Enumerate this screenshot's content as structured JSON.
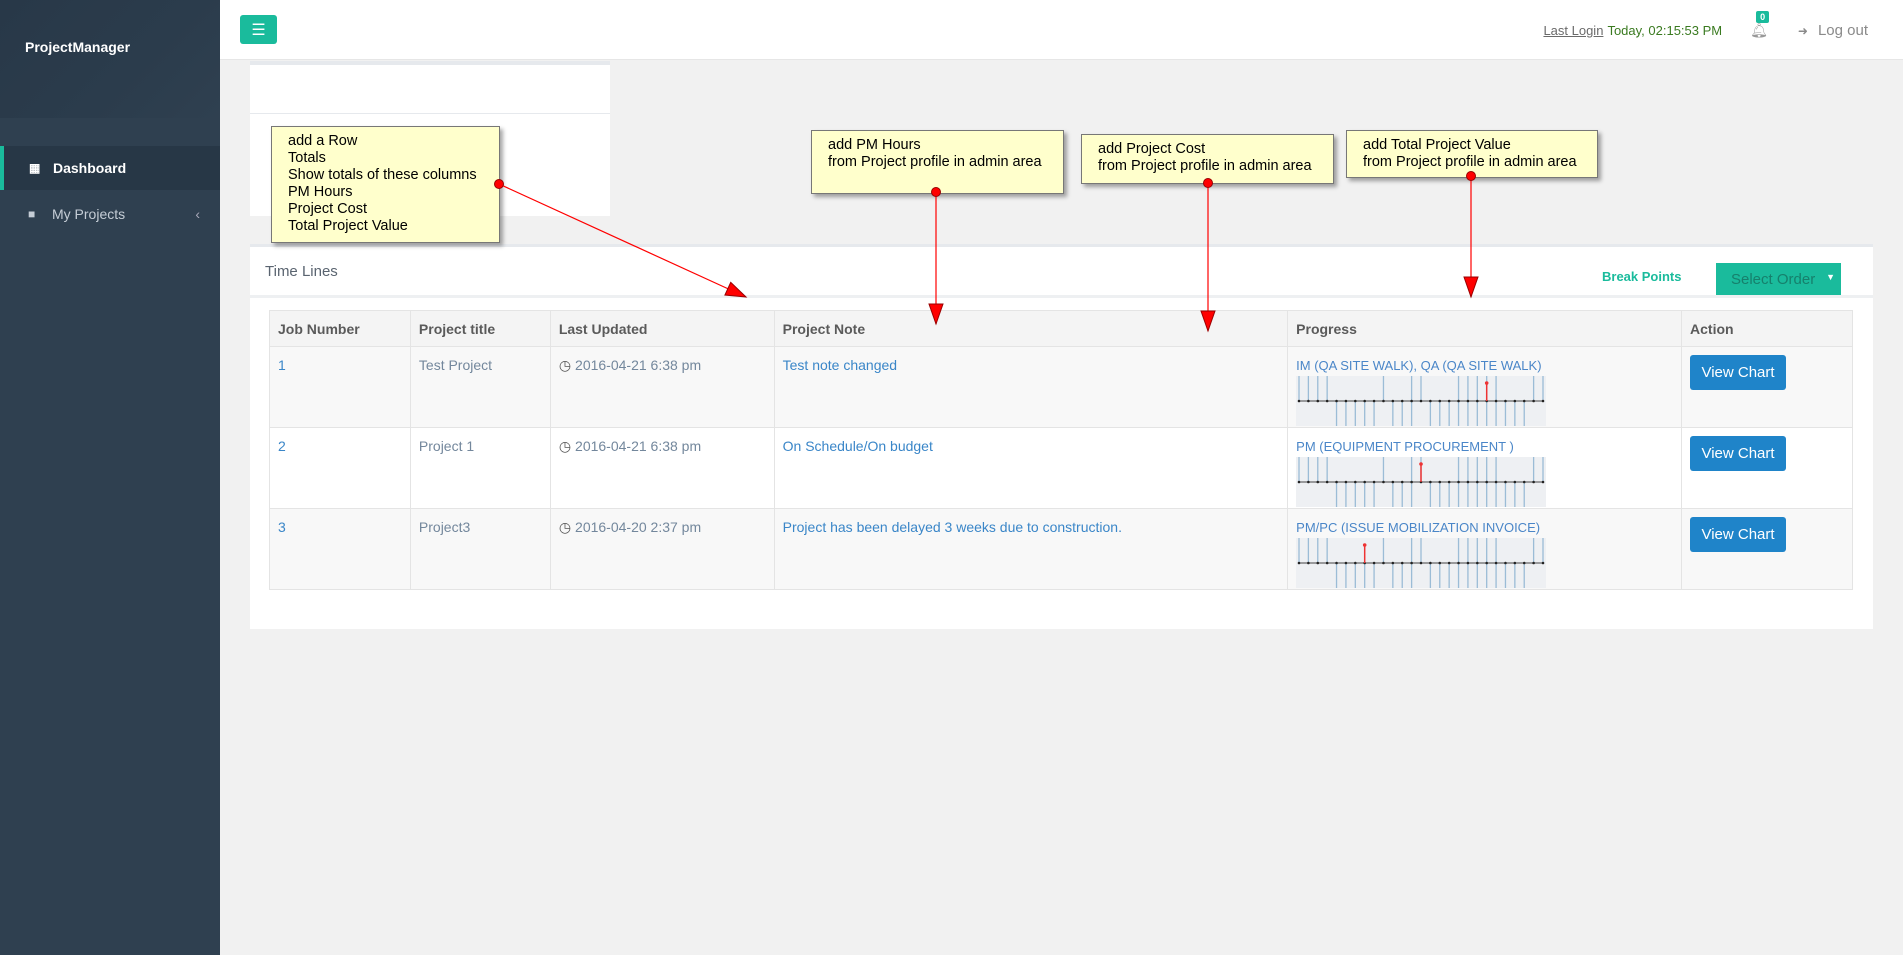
{
  "sidebar": {
    "brand": "ProjectManager",
    "items": [
      {
        "label": "Dashboard",
        "icon": "dashboard-icon"
      },
      {
        "label": "My Projects",
        "icon": "folder-icon"
      }
    ]
  },
  "header": {
    "menu_icon": "hamburger-icon",
    "last_login_label": "Last Login",
    "last_login_value": "Today, 02:15:53 PM",
    "notification_count": "0",
    "logout_label": "Log out"
  },
  "timelines": {
    "title": "Time Lines",
    "break_points_label": "Break Points",
    "select_order_label": "Select Order",
    "columns": [
      "Job Number",
      "Project title",
      "Last Updated",
      "Project Note",
      "Progress",
      "Action"
    ],
    "rows": [
      {
        "job": "1",
        "title": "Test Project",
        "updated": "2016-04-21 6:38 pm",
        "note": "Test note changed",
        "progress": "IM (QA SITE WALK), QA (QA SITE WALK)",
        "current_index": 20,
        "action": "View Chart"
      },
      {
        "job": "2",
        "title": "Project 1",
        "updated": "2016-04-21 6:38 pm",
        "note": "On Schedule/On budget",
        "progress": "PM (EQUIPMENT PROCUREMENT )",
        "current_index": 13,
        "action": "View Chart"
      },
      {
        "job": "3",
        "title": "Project3",
        "updated": "2016-04-20 2:37 pm",
        "note": "Project has been delayed 3 weeks due to construction.",
        "progress": "PM/PC (ISSUE MOBILIZATION INVOICE)",
        "current_index": 7,
        "action": "View Chart"
      }
    ],
    "timeline": {
      "points": 27,
      "up": [
        0,
        1,
        2,
        3,
        9,
        12,
        13,
        17,
        18,
        19,
        20,
        21,
        25,
        26
      ],
      "down": [
        4,
        5,
        6,
        7,
        8,
        10,
        11,
        12,
        14,
        15,
        16,
        17,
        18,
        19,
        20,
        21,
        22,
        23,
        24
      ]
    }
  },
  "annotations": [
    {
      "text": "add a Row\nTotals\nShow totals of these columns\nPM Hours\nProject Cost\nTotal Project Value"
    },
    {
      "text": "add PM Hours\nfrom Project profile in admin area"
    },
    {
      "text": "add Project Cost\nfrom Project profile in admin area"
    },
    {
      "text": "add Total Project Value\nfrom Project profile in admin area"
    }
  ],
  "colors": {
    "accent": "#1abb9c",
    "sidebar": "#2f4050",
    "button": "#1f84c9",
    "note_bg": "#ffffcc",
    "arrow": "#ff0000"
  }
}
